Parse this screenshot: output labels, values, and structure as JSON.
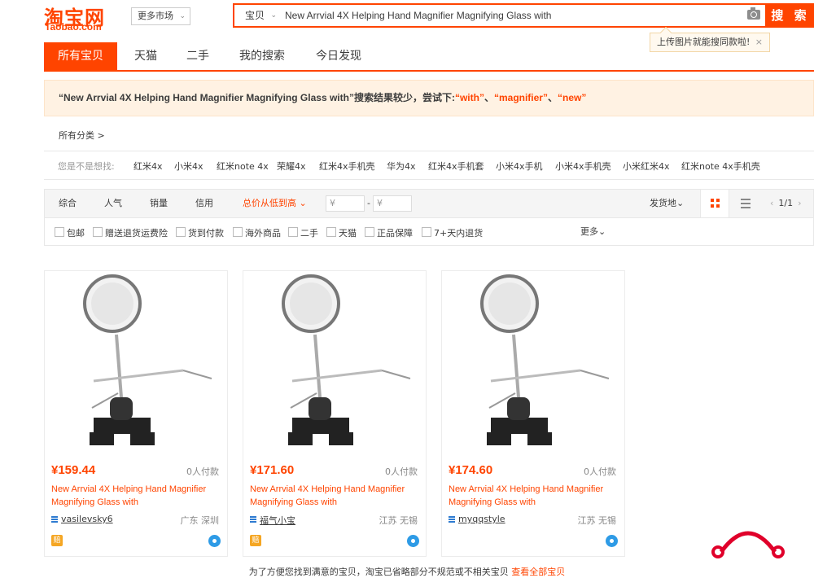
{
  "header": {
    "logo_cn": "淘宝网",
    "logo_en": "Taobao.com",
    "market_label": "更多市场",
    "search_type": "宝贝",
    "search_value": "New Arrvial 4X Helping Hand Magnifier Magnifying Glass with",
    "search_button": "搜 索",
    "tip": "上传图片就能搜同款啦!",
    "tip_close": "×"
  },
  "tabs": [
    "所有宝贝",
    "天猫",
    "二手",
    "我的搜索",
    "今日发现"
  ],
  "notice": {
    "query": "“New Arrvial 4X Helping Hand Magnifier Magnifying Glass with”搜索结果较少，尝试下:",
    "s1": "“with”",
    "sep1": "、",
    "s2": "“magnifier”",
    "sep2": "、",
    "s3": "“new”"
  },
  "breadcrumb": "所有分类 >",
  "suggest": {
    "label": "您是不是想找:",
    "items": [
      "红米4x",
      "小米4x",
      "红米note 4x",
      "荣耀4x",
      "红米4x手机壳",
      "华为4x",
      "红米4x手机套",
      "小米4x手机",
      "小米4x手机壳",
      "小米红米4x",
      "红米note 4x手机壳"
    ]
  },
  "sortbar": {
    "sorts": [
      "综合",
      "人气",
      "销量",
      "信用"
    ],
    "price_sort": "总价从低到高 ⌄",
    "price_min": "¥",
    "price_dash": "-",
    "price_max": "¥",
    "ship_from": "发货地⌄",
    "page_prev": "‹",
    "page": "1/1",
    "page_next": "›"
  },
  "filters": [
    "包邮",
    "赠送退货运费险",
    "货到付款",
    "海外商品",
    "二手",
    "天猫",
    "正品保障",
    "7+天内退货"
  ],
  "filters_more": "更多⌄",
  "products": [
    {
      "price": "¥159.44",
      "paid": "0人付款",
      "title": "New Arrvial 4X Helping Hand Magnifier Magnifying Glass with",
      "shop": "vasilevsky6",
      "loc": "广东 深圳",
      "badge": "赔"
    },
    {
      "price": "¥171.60",
      "paid": "0人付款",
      "title": "New Arrvial 4X Helping Hand Magnifier Magnifying Glass with",
      "shop": "福气小宝",
      "loc": "江苏 无锡",
      "badge": "赔"
    },
    {
      "price": "¥174.60",
      "paid": "0人付款",
      "title": "New Arrvial 4X Helping Hand Magnifier Magnifying Glass with",
      "shop": "myqqstyle",
      "loc": "江苏 无锡",
      "badge": ""
    }
  ],
  "footer": {
    "note": "为了方便您找到满意的宝贝，淘宝已省略部分不规范或不相关宝贝 ",
    "link": "查看全部宝贝"
  },
  "colors": {
    "accent": "#ff4400",
    "notice_bg": "#fff2e3",
    "badge": "#f5a623",
    "wangwang": "#2e9be6"
  }
}
